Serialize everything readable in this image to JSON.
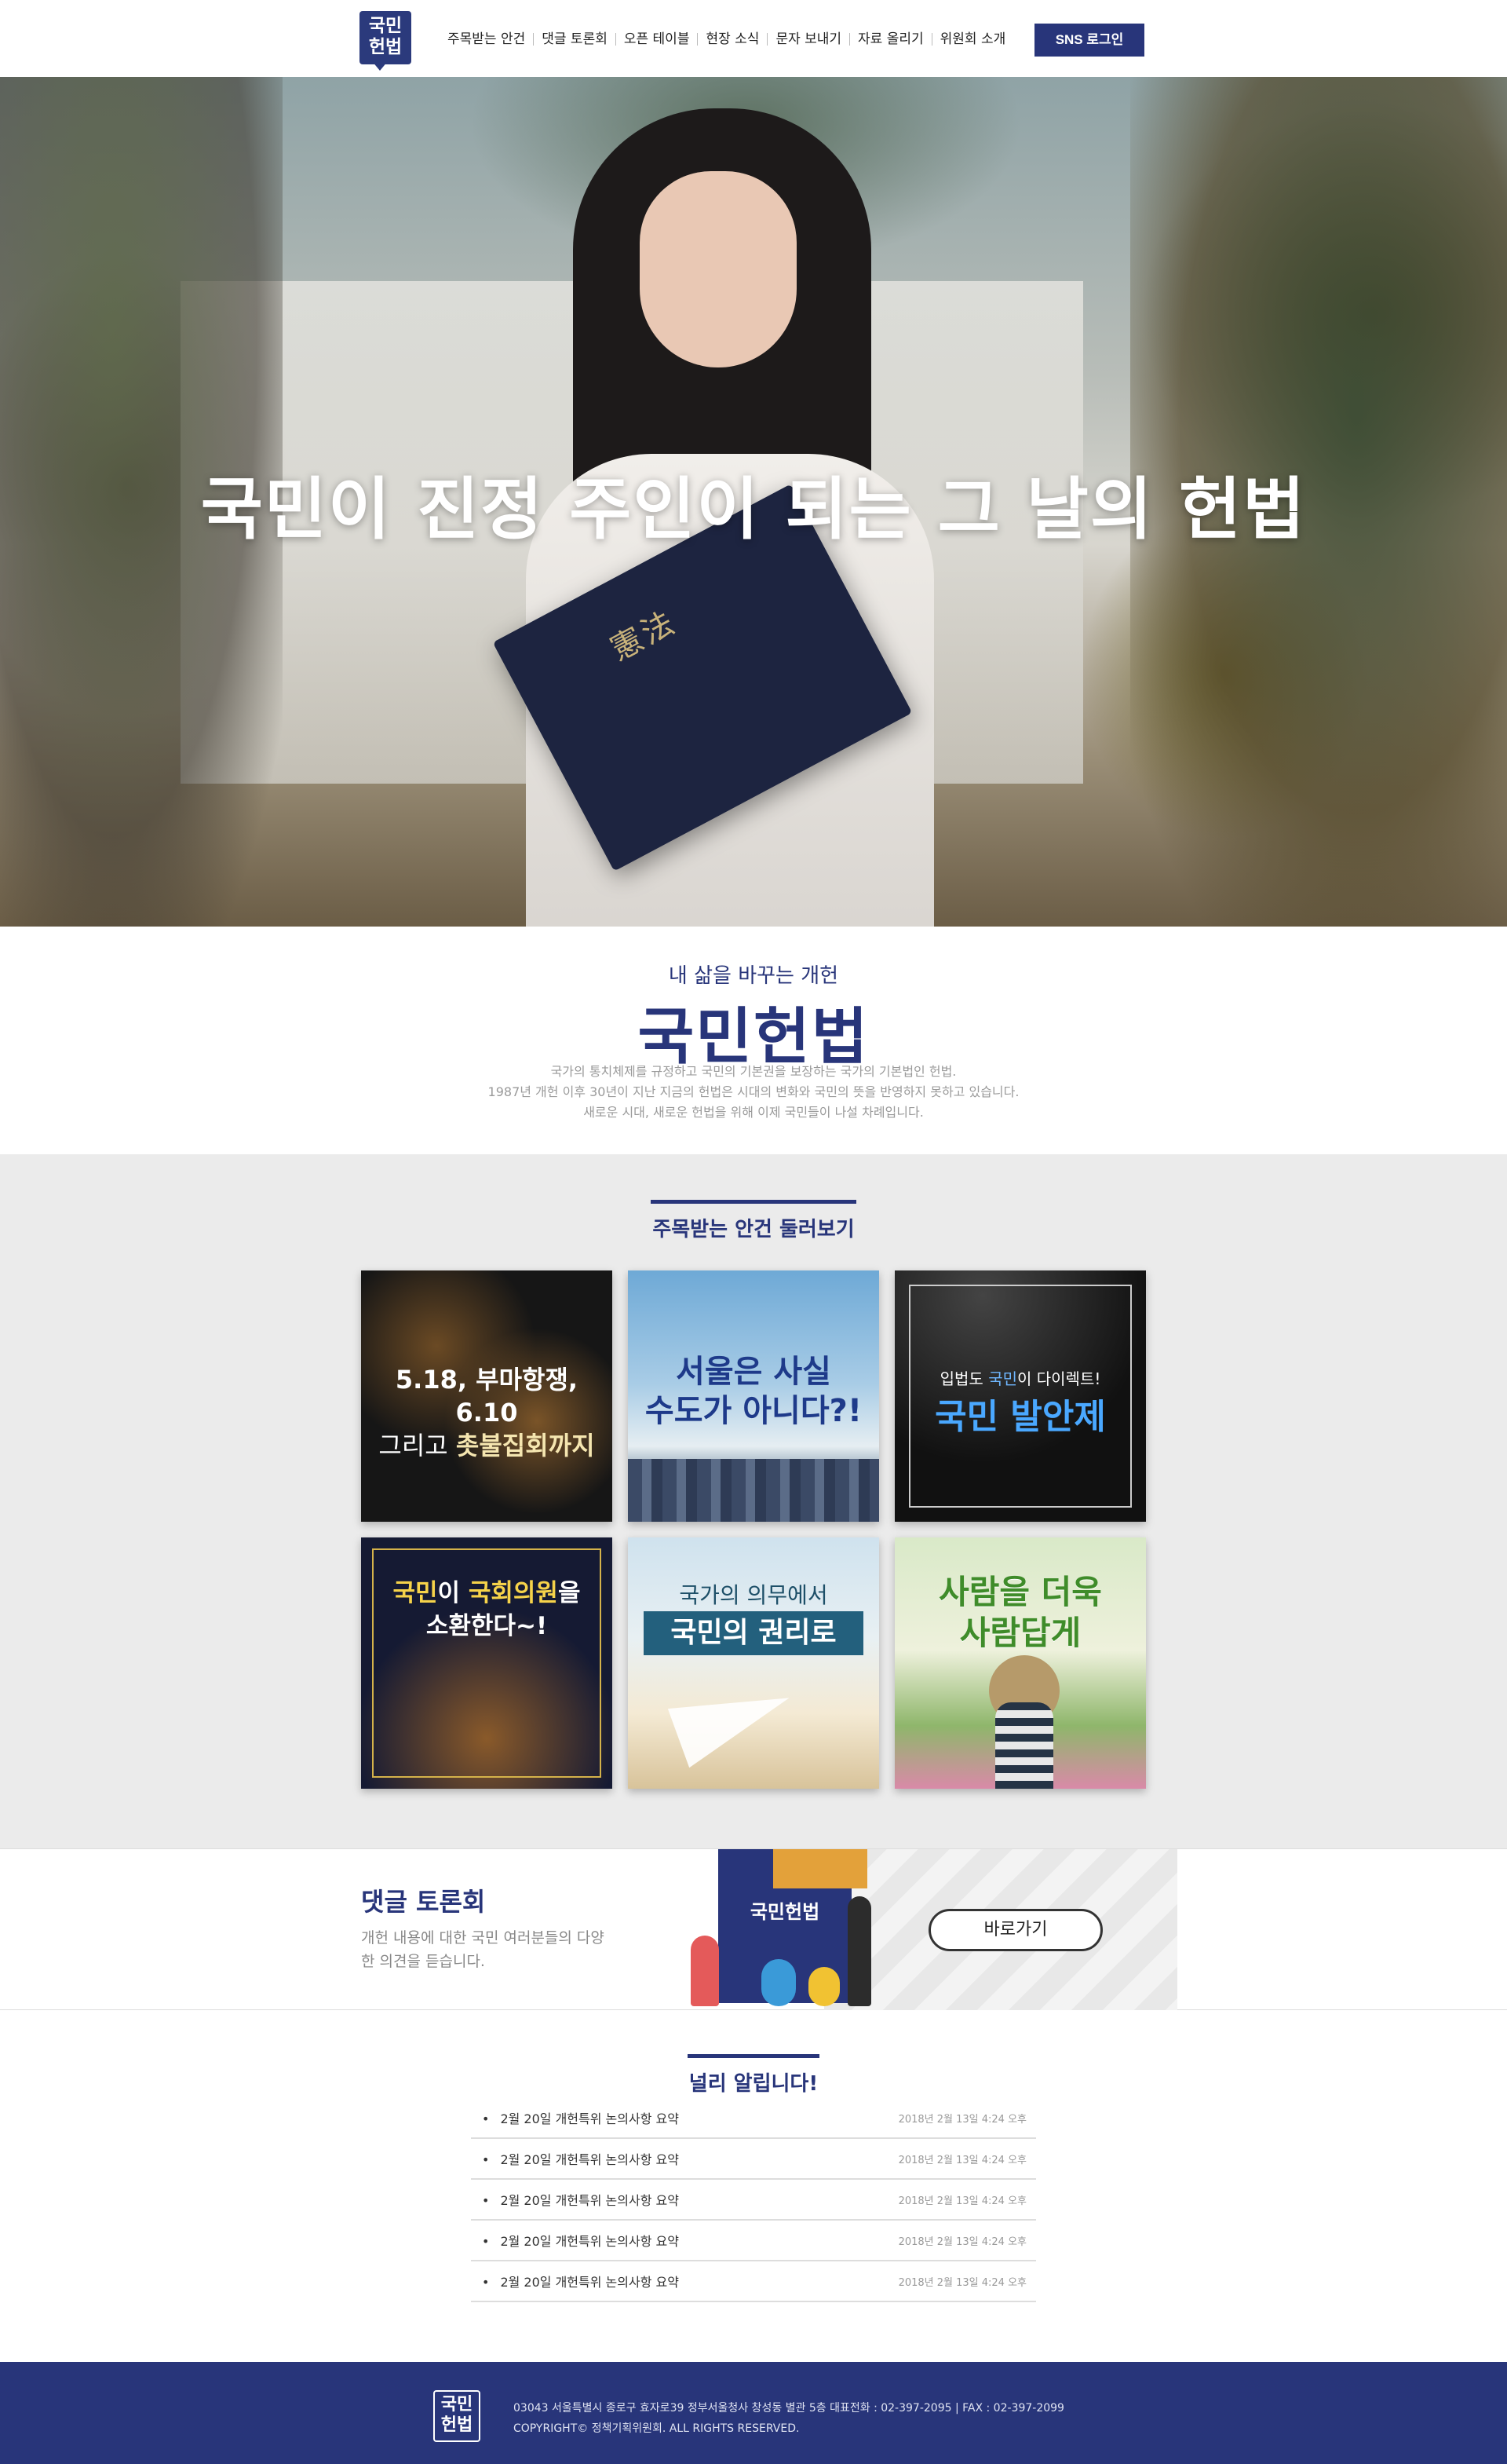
{
  "header": {
    "logo_line1": "국민",
    "logo_line2": "헌법",
    "nav": [
      {
        "label": "주목받는 안건"
      },
      {
        "label": "댓글 토론회"
      },
      {
        "label": "오픈 테이블"
      },
      {
        "label": "현장 소식"
      },
      {
        "label": "문자 보내기"
      },
      {
        "label": "자료 올리기"
      },
      {
        "label": "위원회 소개"
      }
    ],
    "login_label": "SNS 로그인"
  },
  "hero": {
    "title": "국민이 진정 주인이 되는 그 날의 헌법",
    "book_text": "憲法"
  },
  "intro": {
    "subtitle": "내 삶을 바꾸는 개헌",
    "title": "국민헌법",
    "desc": [
      "국가의 통치체제를 규정하고 국민의 기본권을 보장하는 국가의 기본법인 헌법.",
      "1987년 개헌 이후 30년이 지난 지금의 헌법은 시대의 변화와 국민의 뜻을 반영하지 못하고 있습니다.",
      "새로운 시대, 새로운 헌법을 위해 이제 국민들이 나설 차례입니다."
    ]
  },
  "agenda": {
    "heading": "주목받는 안건 둘러보기",
    "cards": [
      {
        "line1": "5.18, 부마항쟁, 6.10",
        "line2_a": "그리고 ",
        "line2_b": "촛불집회까지"
      },
      {
        "line1": "서울은 사실",
        "line2": "수도가 아니다?!"
      },
      {
        "small_a": "입법도 ",
        "small_b": "국민",
        "small_c": "이 다이렉트!",
        "big": "국민 발안제"
      },
      {
        "line1_a": "국민",
        "line1_b": "이 ",
        "line1_c": "국회의원",
        "line1_d": "을",
        "line2": "소환한다~!"
      },
      {
        "line1": "국가의 의무에서",
        "line2": "국민의 권리로"
      },
      {
        "line1": "사람을 더욱",
        "line2": "사람답게"
      }
    ]
  },
  "debate": {
    "title": "댓글 토론회",
    "desc": "개헌 내용에 대한 국민 여러분들의 다양한 의견을 듣습니다.",
    "book_label": "국민헌법",
    "button": "바로가기"
  },
  "notice": {
    "heading": "널리 알립니다!",
    "items": [
      {
        "title": "2월 20일 개헌특위 논의사항 요약",
        "date": "2018년 2월 13일 4:24 오후"
      },
      {
        "title": "2월 20일 개헌특위 논의사항 요약",
        "date": "2018년 2월 13일 4:24 오후"
      },
      {
        "title": "2월 20일 개헌특위 논의사항 요약",
        "date": "2018년 2월 13일 4:24 오후"
      },
      {
        "title": "2월 20일 개헌특위 논의사항 요약",
        "date": "2018년 2월 13일 4:24 오후"
      },
      {
        "title": "2월 20일 개헌특위 논의사항 요약",
        "date": "2018년 2월 13일 4:24 오후"
      }
    ]
  },
  "footer": {
    "logo_line1": "국민",
    "logo_line2": "헌법",
    "address": "03043 서울특별시 종로구 효자로39 정부서울청사 창성동 별관 5층 대표전화 : 02-397-2095 | FAX : 02-397-2099",
    "copyright": "COPYRIGHT© 정책기획위원회. ALL RIGHTS RESERVED."
  },
  "colors": {
    "brand_navy": "#28357a",
    "agenda_bg": "#ebebeb"
  }
}
